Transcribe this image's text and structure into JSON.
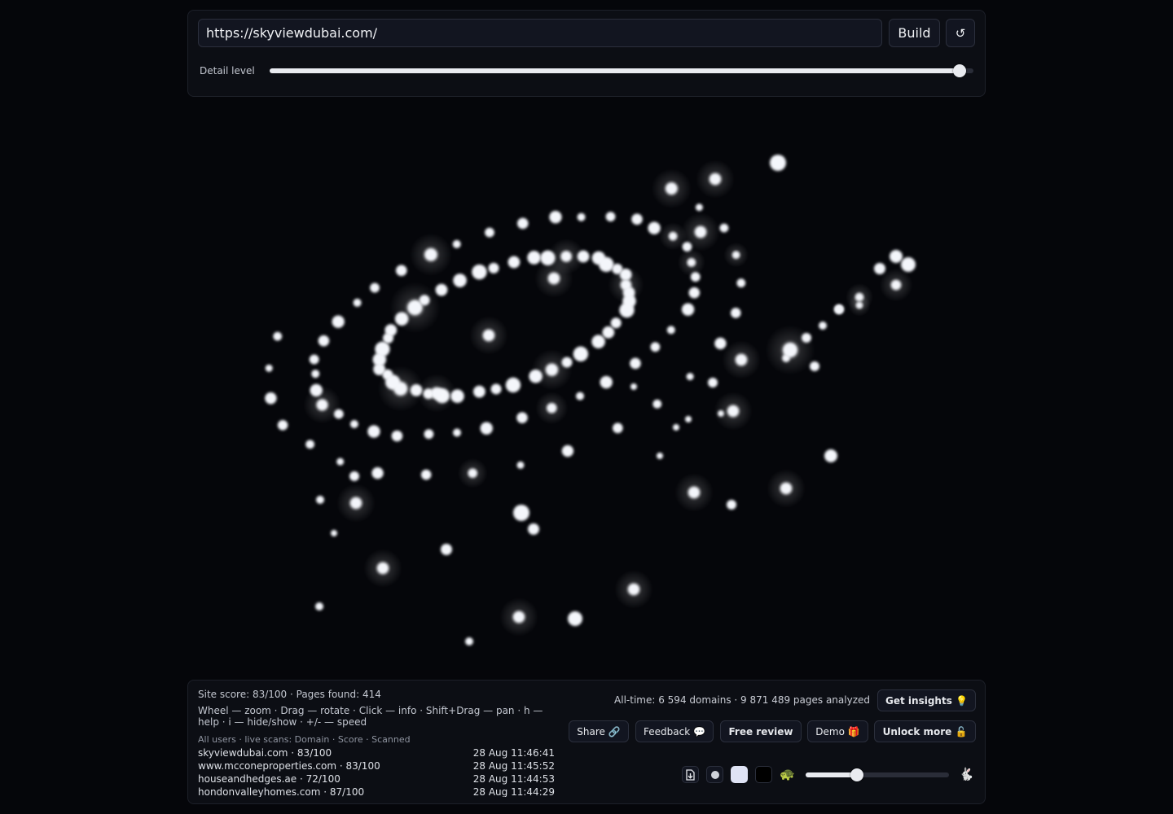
{
  "url_bar": {
    "value": "https://skyviewdubai.com/",
    "build_label": "Build",
    "reset_label": "↺"
  },
  "detail": {
    "label": "Detail level",
    "value_fraction": 0.98
  },
  "stats": {
    "site_line": "Site score: 83/100 · Pages found: 414",
    "help_line": "Wheel — zoom · Drag — rotate · Click — info · Shift+Drag — pan · h — help · i — hide/show · +/- — speed",
    "scans_header": "All users · live scans: Domain · Score · Scanned",
    "all_time": "All-time: 6 594 domains · 9 871 489 pages analyzed"
  },
  "scans": [
    {
      "domain": "skyviewdubai.com · 83/100",
      "time": "28 Aug 11:46:41"
    },
    {
      "domain": "www.mcconeproperties.com · 83/100",
      "time": "28 Aug 11:45:52"
    },
    {
      "domain": "houseandhedges.ae · 72/100",
      "time": "28 Aug 11:44:53"
    },
    {
      "domain": "hondonvalleyhomes.com · 87/100",
      "time": "28 Aug 11:44:29"
    }
  ],
  "actions": {
    "get_insights": "Get insights 💡",
    "share": "Share 🔗",
    "feedback": "Feedback 💬",
    "free_review": "Free review",
    "demo": "Demo 🎁",
    "unlock_more": "Unlock more 🔓"
  },
  "controls": {
    "slow_icon": "🐢",
    "fast_icon": "🐇",
    "speed_fraction": 0.36
  },
  "colors": {
    "background": "#05060a",
    "panel": "#0c0e14",
    "accent": "#e9ebf0"
  }
}
